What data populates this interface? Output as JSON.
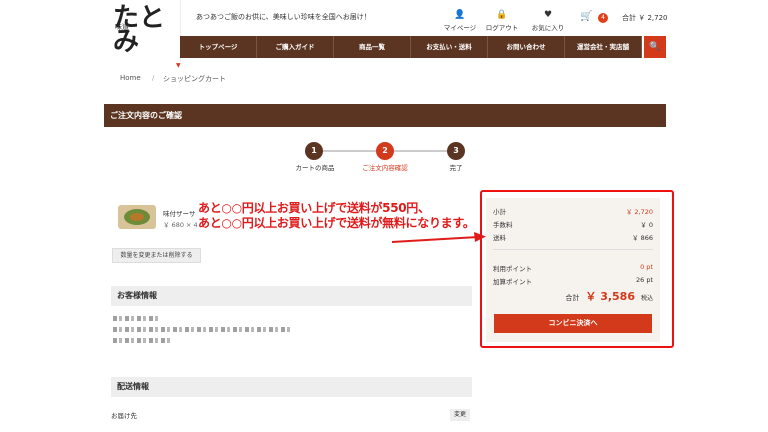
{
  "header": {
    "logo_kanji": "たとみ",
    "logo_sub": "味道",
    "tagline": "あつあつご飯のお供に、美味しい珍味を全国へお届け！",
    "links": [
      {
        "label": "マイページ",
        "icon": "user-icon"
      },
      {
        "label": "ログアウト",
        "icon": "lock-icon"
      },
      {
        "label": "お気に入り",
        "icon": "heart-icon"
      }
    ],
    "cart_count": "4",
    "cart_total": "合計 ￥ 2,720"
  },
  "nav": [
    "トップページ",
    "ご購入ガイド",
    "商品一覧",
    "お支払い・送料",
    "お問い合わせ",
    "運営会社・実店舗"
  ],
  "breadcrumb": [
    "Home",
    "/",
    "ショッピングカート"
  ],
  "page_title": "ご注文内容のご確認",
  "steps": [
    {
      "num": "1",
      "label": "カートの商品",
      "color": "#5b3522"
    },
    {
      "num": "2",
      "label": "ご注文内容確認",
      "color": "#d3391b"
    },
    {
      "num": "3",
      "label": "完了",
      "color": "#5b3522"
    }
  ],
  "product": {
    "name": "味付ザーサ",
    "price": "￥ 680 × 4"
  },
  "change_button": "数量を変更または削除する",
  "customer_section": "お客様情報",
  "delivery_section": "配送情報",
  "delivery_label": "お届け先",
  "delivery_change": "変更",
  "summary": {
    "rows": [
      {
        "label": "小計",
        "value": "￥ 2,720",
        "red": true
      },
      {
        "label": "手数料",
        "value": "￥ 0",
        "red": false
      },
      {
        "label": "送料",
        "value": "￥ 866",
        "red": false
      }
    ],
    "points": [
      {
        "label": "利用ポイント",
        "value": "0 pt",
        "red": true
      },
      {
        "label": "加算ポイント",
        "value": "26 pt",
        "red": false
      }
    ],
    "total_label": "合計",
    "total_value": "￥ 3,586",
    "tax_label": "税込",
    "pay_button": "コンビニ決済へ"
  },
  "annotation": {
    "line1": "あと○○円以上お買い上げで送料が550円、",
    "line2": "あと○○円以上お買い上げで送料が無料になります。"
  },
  "colors": {
    "brand_brown": "#5b3522",
    "accent_red": "#d3391b",
    "highlight": "#e11111"
  }
}
